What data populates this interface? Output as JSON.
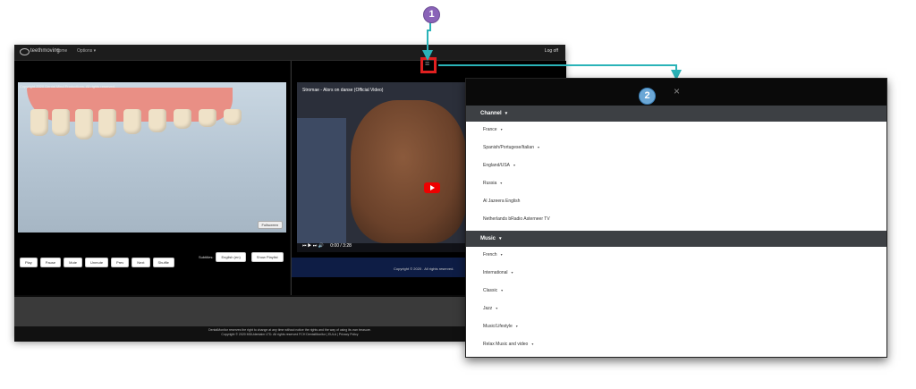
{
  "app": {
    "brand": "teethmoving",
    "nav": [
      "Home",
      "Options ▾"
    ],
    "logout": "Log off"
  },
  "left_video": {
    "copyright": "Copyright 2020 Dental Mind Productions. All rights reserved.",
    "corner_button": "Fullscreen",
    "controls": [
      "Play",
      "Pause",
      "Mute",
      "Unmute",
      "Prev",
      "Next",
      "Shuffle"
    ],
    "subtitles_label": "Subtitles:",
    "subtitles_value": "English (en)",
    "playlist_button": "Show Playlist"
  },
  "right_video": {
    "title": "Stromae - Alors on danse (Official Video)",
    "timecode": "0:00 / 3:28",
    "copyright": "Copyright © 2020 . All rights reserved."
  },
  "footer": {
    "line1": "DentalMonitor reserves the right to change at any time without notice the rights and the way of using its own treasure.",
    "line2": "Copyright © 2020 MDUdentalm LTD. All rights reserved FCH DentalMonitor | EULA | Privacy Policy"
  },
  "callouts": {
    "one": "1",
    "two": "2"
  },
  "panel": {
    "close": "×",
    "sections": [
      {
        "label": "Channel",
        "items": [
          "France",
          "Spanish/Portugese/Italian",
          "England/USA",
          "Russia",
          "Al Jazeera English",
          "Netherlands bRadio Asterneer TV"
        ],
        "has_caret": [
          true,
          true,
          true,
          true,
          false,
          false
        ]
      },
      {
        "label": "Music",
        "items": [
          "French",
          "International",
          "Classic",
          "Jazz",
          "Music/Lifestyle",
          "Relax Music and video"
        ],
        "has_caret": [
          true,
          true,
          true,
          true,
          true,
          true
        ]
      }
    ]
  },
  "colors": {
    "arrow": "#2ab3b8",
    "red_highlight": "#e02020",
    "badge1": "#8a63b8",
    "badge2": "#6ba7d6"
  }
}
